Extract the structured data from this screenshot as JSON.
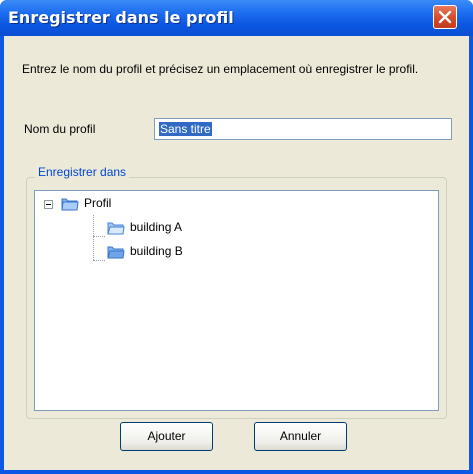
{
  "window": {
    "title": "Enregistrer dans le profil"
  },
  "intro": {
    "text": "Entrez le nom du profil et précisez un emplacement où enregistrer le profil."
  },
  "profile_name": {
    "label": "Nom du profil",
    "value": "Sans titre"
  },
  "save_in": {
    "legend": "Enregistrer dans",
    "root": {
      "label": "Profil",
      "icon": "folder-icon",
      "expanded": true
    },
    "children": [
      {
        "label": "building A",
        "icon": "folder-icon"
      },
      {
        "label": "building B",
        "icon": "folder-icon"
      }
    ]
  },
  "buttons": {
    "add": "Ajouter",
    "cancel": "Annuler"
  },
  "colors": {
    "titlebar": "#0a58e3",
    "client": "#ece9d8",
    "group_label": "#0046d5",
    "selection": "#316ac5"
  }
}
